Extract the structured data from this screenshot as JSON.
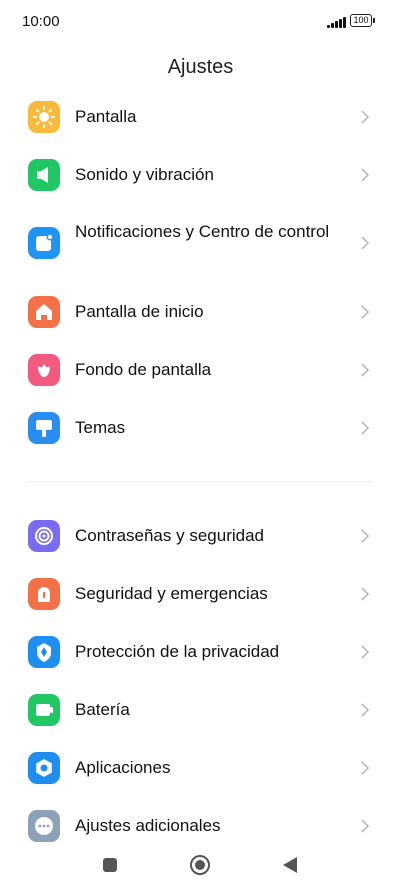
{
  "status_bar": {
    "time": "10:00",
    "battery": "100"
  },
  "header": {
    "title": "Ajustes"
  },
  "group1": [
    {
      "label": "Pantalla",
      "icon": "sun-icon",
      "color": "#f9b93a"
    },
    {
      "label": "Sonido y vibración",
      "icon": "speaker-icon",
      "color": "#21c764"
    },
    {
      "label": "Notificaciones y Centro de control",
      "icon": "notification-icon",
      "color": "#1e95f4"
    },
    {
      "label": "Pantalla de inicio",
      "icon": "home-icon",
      "color": "#f47148"
    },
    {
      "label": "Fondo de pantalla",
      "icon": "flower-icon",
      "color": "#f25b7d"
    },
    {
      "label": "Temas",
      "icon": "brush-icon",
      "color": "#2a8ef0"
    }
  ],
  "group2": [
    {
      "label": "Contraseñas y seguridad",
      "icon": "fingerprint-icon",
      "color": "#7a6cf0"
    },
    {
      "label": "Seguridad y emergencias",
      "icon": "emergency-icon",
      "color": "#f47148"
    },
    {
      "label": "Protección de la privacidad",
      "icon": "shield-icon",
      "color": "#1e8ff0"
    },
    {
      "label": "Batería",
      "icon": "battery-icon",
      "color": "#21c764"
    },
    {
      "label": "Aplicaciones",
      "icon": "gear-icon",
      "color": "#1e8ff0"
    },
    {
      "label": "Ajustes adicionales",
      "icon": "more-icon",
      "color": "#8ba2b8"
    }
  ]
}
